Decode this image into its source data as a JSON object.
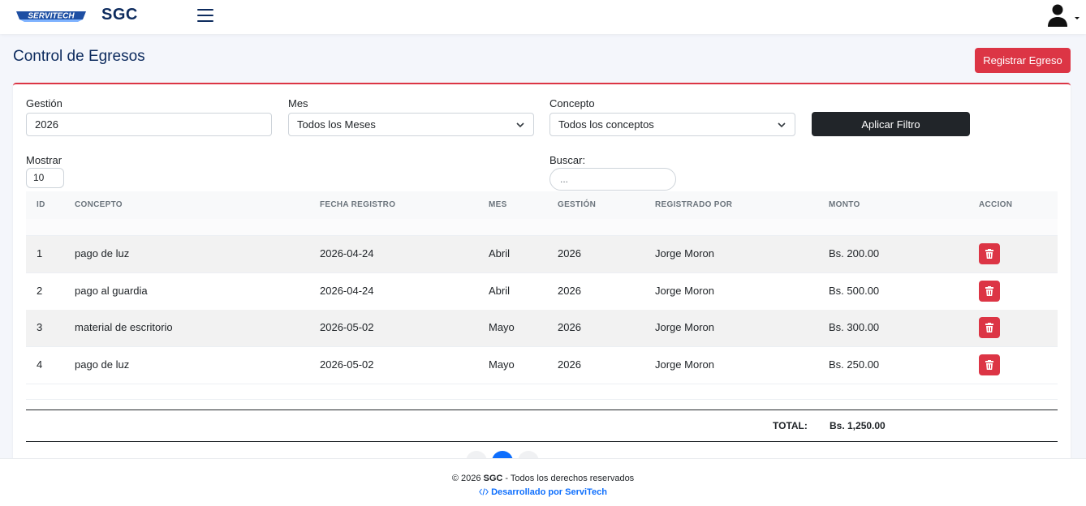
{
  "navbar": {
    "logo_text": "SERVITECH",
    "brand": "SGC"
  },
  "page": {
    "title": "Control de Egresos",
    "register_button": "Registrar Egreso"
  },
  "filters": {
    "gestion_label": "Gestión",
    "gestion_value": "2026",
    "mes_label": "Mes",
    "mes_value": "Todos los Meses",
    "concepto_label": "Concepto",
    "concepto_value": "Todos los conceptos",
    "apply_button": "Aplicar Filtro",
    "show_label": "Mostrar",
    "show_value": "10",
    "search_label": "Buscar:",
    "search_placeholder": "..."
  },
  "table": {
    "headers": [
      "ID",
      "CONCEPTO",
      "FECHA REGISTRO",
      "MES",
      "GESTIÓN",
      "REGISTRADO POR",
      "MONTO",
      "ACCION"
    ],
    "rows": [
      {
        "id": "1",
        "concepto": "pago de luz",
        "fecha": "2026-04-24",
        "mes": "Abril",
        "gestion": "2026",
        "registrado": "Jorge Moron",
        "monto": "Bs. 200.00"
      },
      {
        "id": "2",
        "concepto": "pago al guardia",
        "fecha": "2026-04-24",
        "mes": "Abril",
        "gestion": "2026",
        "registrado": "Jorge Moron",
        "monto": "Bs. 500.00"
      },
      {
        "id": "3",
        "concepto": "material de escritorio",
        "fecha": "2026-05-02",
        "mes": "Mayo",
        "gestion": "2026",
        "registrado": "Jorge Moron",
        "monto": "Bs. 300.00"
      },
      {
        "id": "4",
        "concepto": "pago de luz",
        "fecha": "2026-05-02",
        "mes": "Mayo",
        "gestion": "2026",
        "registrado": "Jorge Moron",
        "monto": "Bs. 250.00"
      }
    ],
    "total_label": "TOTAL:",
    "total_value": "Bs. 1,250.00"
  },
  "footer": {
    "copyright_prefix": "© 2026 ",
    "copyright_brand": "SGC",
    "copyright_suffix": " - Todos los derechos reservados",
    "developer": "Desarrollado por ServiTech"
  },
  "icons": [
    "hamburger-icon",
    "user-icon",
    "chevron-down-icon",
    "trash-icon",
    "code-icon"
  ],
  "colors": {
    "primary_dark": "#0d2b5e",
    "danger": "#dc3545",
    "dark": "#212529",
    "link": "#0d6efd"
  }
}
